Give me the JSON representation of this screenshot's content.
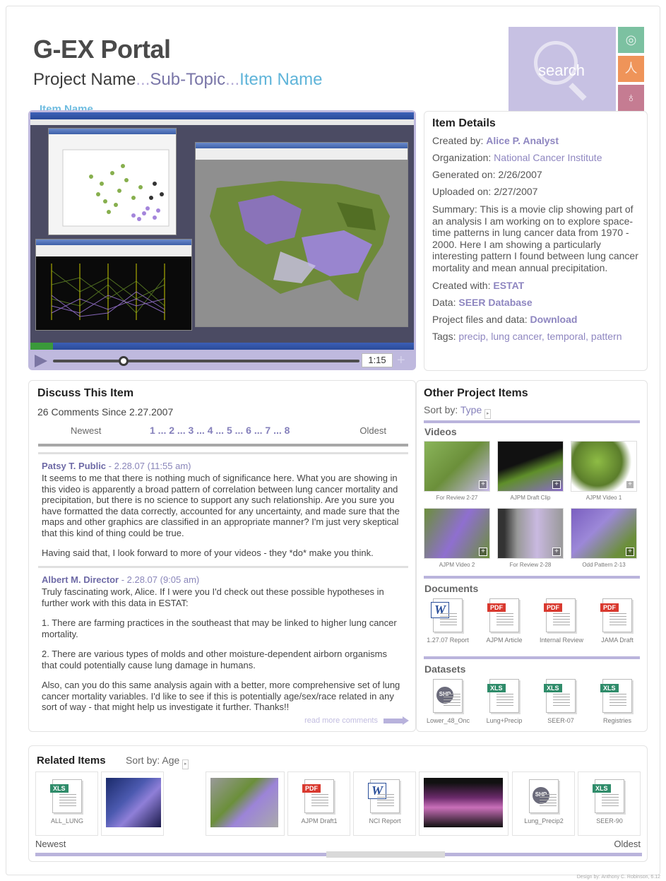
{
  "app": {
    "title": "G-EX Portal",
    "breadcrumb": {
      "project": "Project Name",
      "sep1": "...",
      "subtopic": "Sub-Topic",
      "sep2": "...",
      "item": "Item Name"
    },
    "search_label": "search"
  },
  "video": {
    "item_label": "Item Name",
    "time": "1:15",
    "progress_percent": 23,
    "plus": "+"
  },
  "details": {
    "heading": "Item Details",
    "created_by_label": "Created by:",
    "created_by": "Alice P. Analyst",
    "organization_label": "Organization:",
    "organization": "National Cancer Institute",
    "generated_label": "Generated on:",
    "generated": "2/26/2007",
    "uploaded_label": "Uploaded on:",
    "uploaded": "2/27/2007",
    "summary_label": "Summary:",
    "summary": "This is a movie clip showing part of an analysis I am working on to explore space-time patterns in lung cancer data from 1970 - 2000. Here I am showing a particularly interesting pattern I found between lung cancer mortality and mean annual precipitation.",
    "created_with_label": "Created with:",
    "created_with": "ESTAT",
    "data_label": "Data:",
    "data": "SEER Database",
    "files_label": "Project files and data:",
    "files": "Download",
    "tags_label": "Tags:",
    "tags": "precip, lung cancer, temporal, pattern"
  },
  "discuss": {
    "heading": "Discuss This Item",
    "count": "26 Comments Since 2.27.2007",
    "newest": "Newest",
    "oldest": "Oldest",
    "pages": "1 ... 2 ... 3 ... 4 ... 5 ... 6 ... 7 ... 8",
    "comments": [
      {
        "author": "Patsy T. Public",
        "date": " - 2.28.07 (11:55 am)",
        "p1": "It seems to me that there is nothing much of significance here. What you are showing in this video is apparently a broad pattern of correlation between lung cancer mortality and precipitation, but there is no science to support any such relationship. Are you sure you have formatted the data correctly, accounted for any uncertainty, and made sure that the maps and other graphics are classified in an appropriate manner? I'm just very skeptical that this kind of thing could be true.",
        "p2": "Having said that, I look forward to more of your videos - they *do* make you think."
      },
      {
        "author": "Albert M. Director",
        "date": " - 2.28.07 (9:05 am)",
        "p1": "Truly fascinating work, Alice. If I were you I'd check out these possible hypotheses in further work with this data in ESTAT:",
        "p2": "1. There are farming practices in the southeast that may be linked to higher lung cancer mortality.",
        "p3": "2. There are various types of molds and other moisture-dependent airborn organisms that could potentially cause lung damage in humans.",
        "p4": "Also, can you do this same analysis again with a better, more comprehensive set of lung cancer mortality variables. I'd like to see if this is potentially age/sex/race related in any sort of way - that might help us investigate it further. Thanks!!"
      }
    ],
    "read_more": "read more comments"
  },
  "other": {
    "heading": "Other Project Items",
    "sort_label": "Sort by:",
    "sort_value": "Type",
    "videos_title": "Videos",
    "videos": [
      "For Review 2-27",
      "AJPM Draft Clip",
      "AJPM Video 1",
      "AJPM Video 2",
      "For Review 2-28",
      "Odd Pattern 2-13"
    ],
    "documents_title": "Documents",
    "documents": [
      {
        "type": "W",
        "label": "1.27.07 Report"
      },
      {
        "type": "PDF",
        "label": "AJPM Article"
      },
      {
        "type": "PDF",
        "label": "Internal Review"
      },
      {
        "type": "PDF",
        "label": "JAMA Draft"
      }
    ],
    "datasets_title": "Datasets",
    "datasets": [
      {
        "type": "SHP",
        "label": "Lower_48_Onc"
      },
      {
        "type": "XLS",
        "label": "Lung+Precip"
      },
      {
        "type": "XLS",
        "label": "SEER-07"
      },
      {
        "type": "XLS",
        "label": "Registries"
      }
    ]
  },
  "related": {
    "heading": "Related Items",
    "sort_label": "Sort by:",
    "sort_value": "Age",
    "items": [
      {
        "type": "XLS",
        "label": "ALL_LUNG"
      },
      {
        "type": "image",
        "label": ""
      },
      {
        "type": "map",
        "label": ""
      },
      {
        "type": "PDF",
        "label": "AJPM Draft1"
      },
      {
        "type": "W",
        "label": "NCI Report"
      },
      {
        "type": "video",
        "label": ""
      },
      {
        "type": "SHP",
        "label": "Lung_Precip2"
      },
      {
        "type": "XLS",
        "label": "SEER-90"
      }
    ],
    "newest": "Newest",
    "oldest": "Oldest"
  },
  "credit": "Design by: Anthony C. Robinson, 6.12",
  "colors": {
    "accent": "#8e86c0",
    "link_blue": "#5fb4d9",
    "rule": "#bab4dc"
  }
}
